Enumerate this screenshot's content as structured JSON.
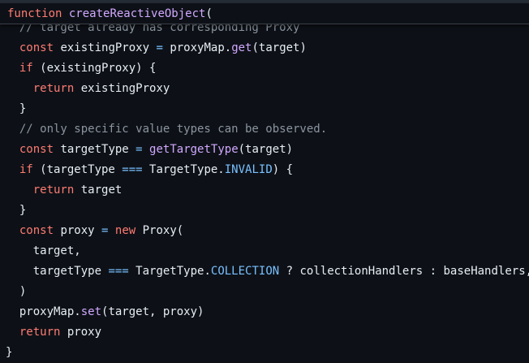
{
  "sticky_header": {
    "keyword": "function",
    "name": "createReactiveObject",
    "punct": "("
  },
  "code_lines": [
    {
      "indent": "  ",
      "tokens": [
        {
          "t": "// target already has corresponding Proxy",
          "c": "cm"
        }
      ]
    },
    {
      "indent": "  ",
      "tokens": [
        {
          "t": "const",
          "c": "kw"
        },
        {
          "t": " existingProxy ",
          "c": "pl"
        },
        {
          "t": "=",
          "c": "op"
        },
        {
          "t": " proxyMap.",
          "c": "pl"
        },
        {
          "t": "get",
          "c": "fn"
        },
        {
          "t": "(target)",
          "c": "pl"
        }
      ]
    },
    {
      "indent": "  ",
      "tokens": [
        {
          "t": "if",
          "c": "kw"
        },
        {
          "t": " (existingProxy) {",
          "c": "pl"
        }
      ]
    },
    {
      "indent": "    ",
      "tokens": [
        {
          "t": "return",
          "c": "kw"
        },
        {
          "t": " existingProxy",
          "c": "pl"
        }
      ]
    },
    {
      "indent": "  ",
      "tokens": [
        {
          "t": "}",
          "c": "pl"
        }
      ]
    },
    {
      "indent": "  ",
      "tokens": [
        {
          "t": "// only specific value types can be observed.",
          "c": "cm"
        }
      ]
    },
    {
      "indent": "  ",
      "tokens": [
        {
          "t": "const",
          "c": "kw"
        },
        {
          "t": " targetType ",
          "c": "pl"
        },
        {
          "t": "=",
          "c": "op"
        },
        {
          "t": " ",
          "c": "pl"
        },
        {
          "t": "getTargetType",
          "c": "fn"
        },
        {
          "t": "(target)",
          "c": "pl"
        }
      ]
    },
    {
      "indent": "  ",
      "tokens": [
        {
          "t": "if",
          "c": "kw"
        },
        {
          "t": " (targetType ",
          "c": "pl"
        },
        {
          "t": "===",
          "c": "op"
        },
        {
          "t": " TargetType.",
          "c": "pl"
        },
        {
          "t": "INVALID",
          "c": "prop"
        },
        {
          "t": ") {",
          "c": "pl"
        }
      ]
    },
    {
      "indent": "    ",
      "tokens": [
        {
          "t": "return",
          "c": "kw"
        },
        {
          "t": " target",
          "c": "pl"
        }
      ]
    },
    {
      "indent": "  ",
      "tokens": [
        {
          "t": "}",
          "c": "pl"
        }
      ]
    },
    {
      "indent": "  ",
      "tokens": [
        {
          "t": "const",
          "c": "kw"
        },
        {
          "t": " proxy ",
          "c": "pl"
        },
        {
          "t": "=",
          "c": "op"
        },
        {
          "t": " ",
          "c": "pl"
        },
        {
          "t": "new",
          "c": "kw"
        },
        {
          "t": " Proxy(",
          "c": "pl"
        }
      ]
    },
    {
      "indent": "    ",
      "tokens": [
        {
          "t": "target,",
          "c": "pl"
        }
      ]
    },
    {
      "indent": "    ",
      "tokens": [
        {
          "t": "targetType ",
          "c": "pl"
        },
        {
          "t": "===",
          "c": "op"
        },
        {
          "t": " TargetType.",
          "c": "pl"
        },
        {
          "t": "COLLECTION",
          "c": "prop"
        },
        {
          "t": " ? collectionHandlers : baseHandlers,",
          "c": "pl"
        }
      ]
    },
    {
      "indent": "  ",
      "tokens": [
        {
          "t": ")",
          "c": "pl"
        }
      ]
    },
    {
      "indent": "  ",
      "tokens": [
        {
          "t": "proxyMap.",
          "c": "pl"
        },
        {
          "t": "set",
          "c": "fn"
        },
        {
          "t": "(target, proxy)",
          "c": "pl"
        }
      ]
    },
    {
      "indent": "  ",
      "tokens": [
        {
          "t": "return",
          "c": "kw"
        },
        {
          "t": " proxy",
          "c": "pl"
        }
      ]
    },
    {
      "indent": "",
      "tokens": [
        {
          "t": "}",
          "c": "pl"
        }
      ]
    }
  ],
  "colors": {
    "background": "#0d1117",
    "keyword": "#ff7b72",
    "function": "#d2a8ff",
    "comment": "#8b949e",
    "constant": "#79c0ff",
    "text": "#e6edf3"
  }
}
